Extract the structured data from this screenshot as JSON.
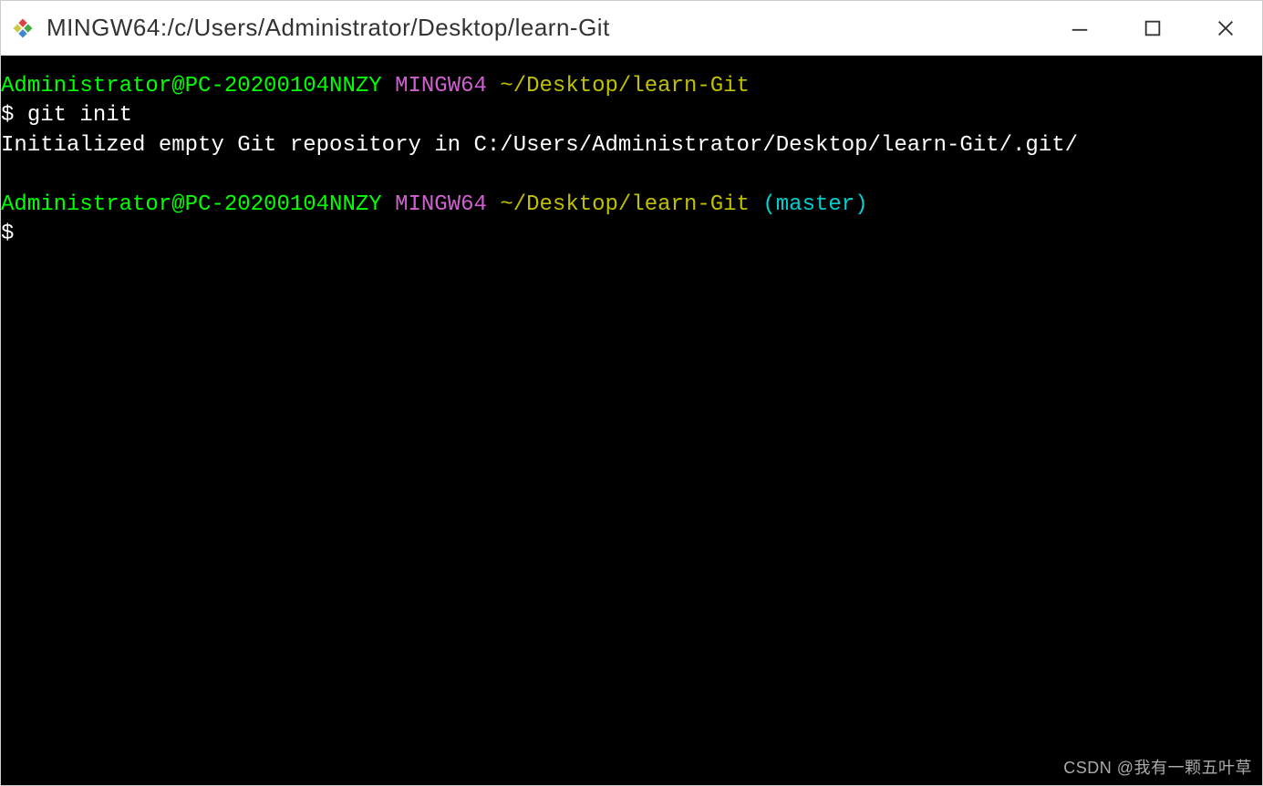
{
  "titlebar": {
    "title": "MINGW64:/c/Users/Administrator/Desktop/learn-Git"
  },
  "terminal": {
    "prompt1": {
      "user_host": "Administrator@PC-20200104NNZY",
      "shell": "MINGW64",
      "path": "~/Desktop/learn-Git"
    },
    "command1_prefix": "$ ",
    "command1": "git init",
    "output1": "Initialized empty Git repository in C:/Users/Administrator/Desktop/learn-Git/.git/",
    "prompt2": {
      "user_host": "Administrator@PC-20200104NNZY",
      "shell": "MINGW64",
      "path": "~/Desktop/learn-Git",
      "branch": "(master)"
    },
    "command2_prefix": "$"
  },
  "watermark": "CSDN @我有一颗五叶草"
}
